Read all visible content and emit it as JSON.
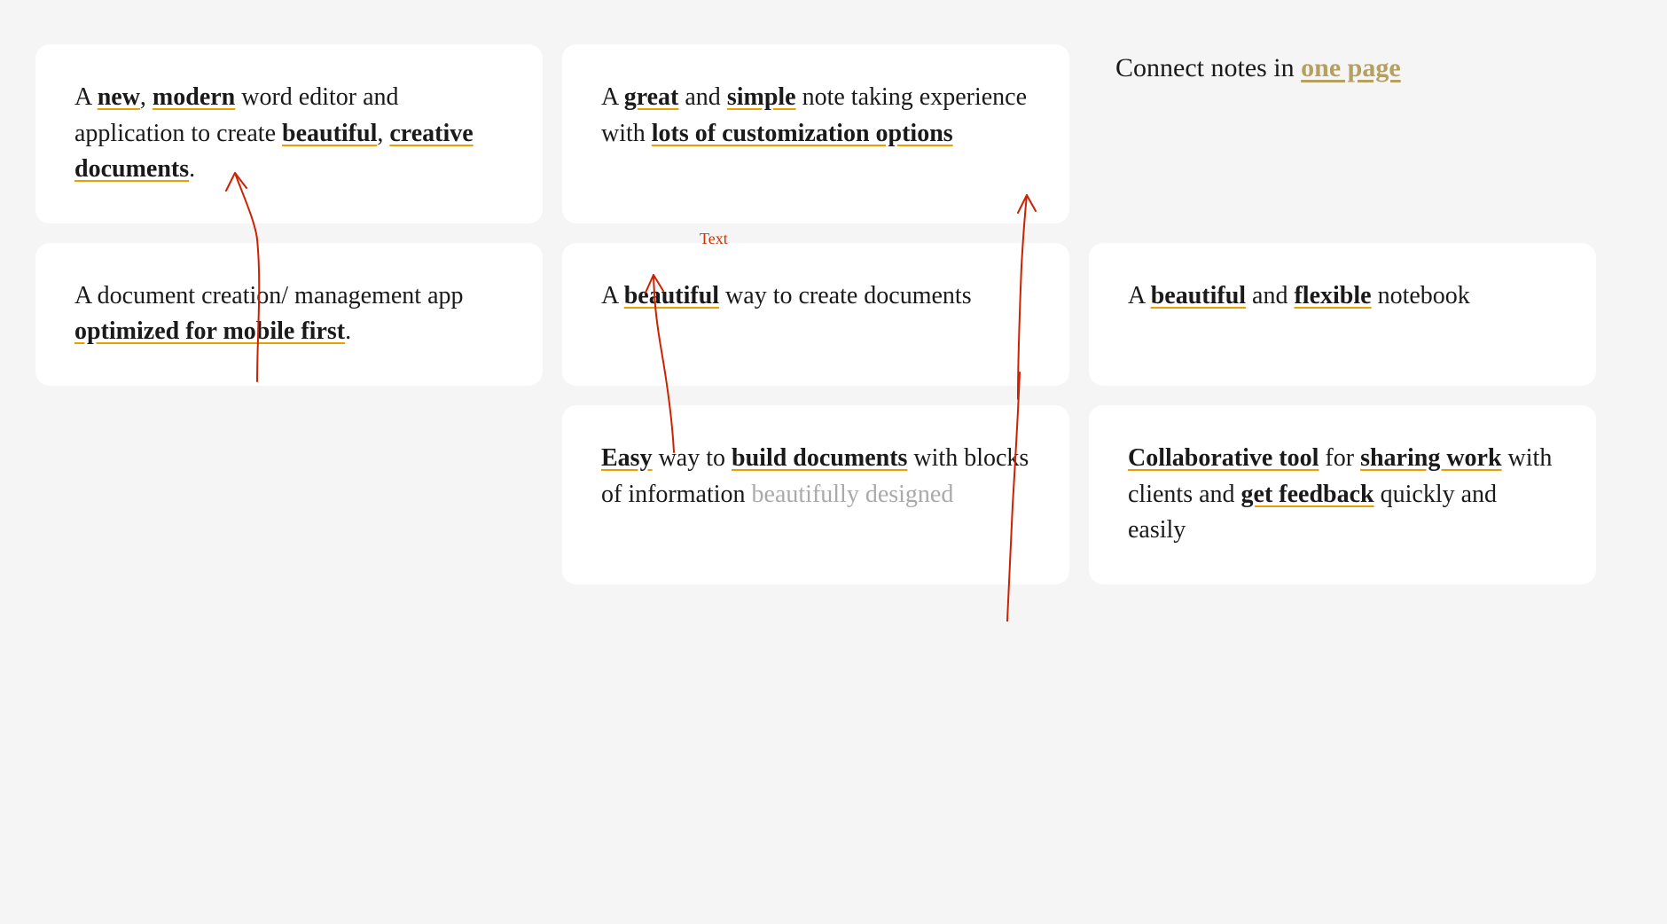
{
  "header": {
    "connect_text": "Connect",
    "notes_in": " notes in ",
    "one_page": "one page"
  },
  "cards": {
    "card1": {
      "prefix": "A ",
      "new": "new",
      "comma1": ", ",
      "modern": "modern",
      "middle1": " word editor and application to create ",
      "beautiful": "beautiful",
      "comma2": ", ",
      "creative": "creative",
      "newline": "",
      "documents": "documents",
      "suffix": "."
    },
    "card2": {
      "prefix": "A ",
      "great": "great",
      "and": " and ",
      "simple": "simple",
      "middle1": " note taking experience with ",
      "lots": "lots of customization options"
    },
    "card3": {
      "prefix": "A document creation/ management app ",
      "optimized": "optimized for mobile first",
      "suffix": "."
    },
    "card4": {
      "text_label": "Text",
      "prefix": "A ",
      "beautiful": "beautiful",
      "suffix": " way to create documents"
    },
    "card5": {
      "prefix": "A ",
      "beautiful": "beautiful",
      "and": " and ",
      "flexible": "flexible",
      "suffix": " notebook"
    },
    "card6": {
      "easy": "Easy",
      "middle1": " way to ",
      "build_documents": "build documents",
      "middle2": " with blocks of information beautifully designed"
    },
    "card7": {
      "collaborative": "Collaborative tool",
      "middle1": " for ",
      "sharing_work": "sharing work",
      "middle2": " with clients and ",
      "get_feedback": "get feedback",
      "suffix": " quickly and easily"
    }
  }
}
